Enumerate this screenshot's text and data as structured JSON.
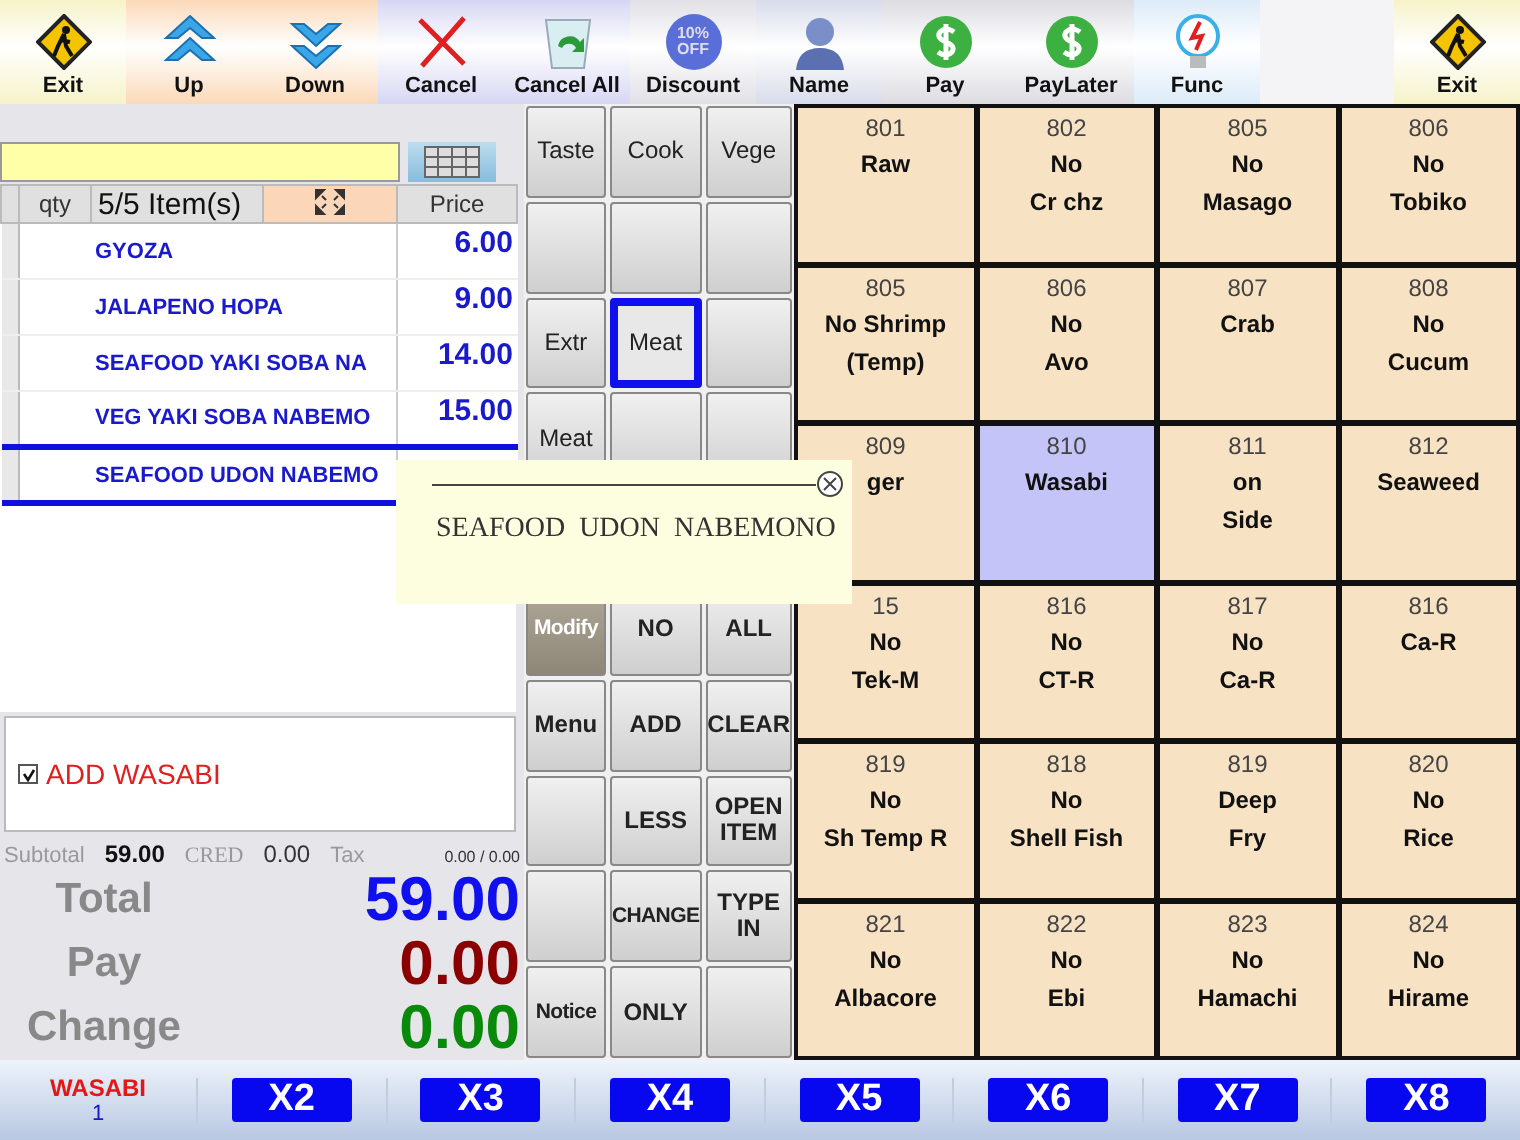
{
  "toolbar": [
    {
      "label": "Exit",
      "kind": "exit"
    },
    {
      "label": "Up",
      "kind": "up"
    },
    {
      "label": "Down",
      "kind": "down"
    },
    {
      "label": "Cancel",
      "kind": "cancel"
    },
    {
      "label": "Cancel All",
      "kind": "cancel_all"
    },
    {
      "label": "Discount",
      "kind": "discount",
      "badge": [
        "10%",
        "OFF"
      ]
    },
    {
      "label": "Name",
      "kind": "person"
    },
    {
      "label": "Pay",
      "kind": "pay"
    },
    {
      "label": "PayLater",
      "kind": "pay"
    },
    {
      "label": "Func",
      "kind": "func"
    },
    {
      "label": "Exit",
      "kind": "exit"
    }
  ],
  "order": {
    "columns": [
      "qty",
      "5/5 Item(s)",
      "Price"
    ],
    "rows": [
      {
        "item": "GYOZA",
        "price": "6.00",
        "selected": false
      },
      {
        "item": "JALAPENO HOPA",
        "price": "9.00",
        "selected": false
      },
      {
        "item": "SEAFOOD YAKI SOBA NA",
        "price": "14.00",
        "selected": false
      },
      {
        "item": "VEG YAKI SOBA NABEMO",
        "price": "15.00",
        "selected": false
      },
      {
        "item": "SEAFOOD UDON NABEMO",
        "price": "",
        "selected": true
      }
    ]
  },
  "modifiers": [
    {
      "label": "ADD WASABI",
      "checked": true
    }
  ],
  "summary": {
    "subtotal_label": "Subtotal",
    "subtotal": "59.00",
    "cred_label": "CRED",
    "cred": "0.00",
    "tax_label": "Tax",
    "tax": "0.00 / 0.00"
  },
  "totals": [
    {
      "label": "Total",
      "value": "59.00",
      "color": "#1010ee"
    },
    {
      "label": "Pay",
      "value": "0.00",
      "color": "#8b0000"
    },
    {
      "label": "Change",
      "value": "0.00",
      "color": "#0a8a0a"
    }
  ],
  "popup": {
    "text": "SEAFOOD  UDON  NABEMONO"
  },
  "keys": [
    {
      "label": "Taste",
      "selected": false,
      "kind": "key"
    },
    {
      "label": "Cook",
      "selected": false,
      "kind": "key"
    },
    {
      "label": "Vege",
      "selected": false,
      "kind": "key"
    },
    {
      "selected": false,
      "kind": "key"
    },
    {
      "selected": false,
      "kind": "key"
    },
    {
      "selected": false,
      "kind": "key"
    },
    {
      "label": "Extr",
      "selected": false,
      "kind": "key"
    },
    {
      "label": "Meat",
      "selected": true,
      "kind": "key"
    },
    {
      "selected": false,
      "kind": "key"
    },
    {
      "label": "Meat",
      "selected": false,
      "kind": "key"
    },
    {
      "selected": false,
      "kind": "key"
    },
    {
      "selected": false,
      "kind": "key"
    },
    {
      "label": "Modify",
      "selected": false,
      "kind": "mode"
    },
    {
      "label": "NO",
      "selected": false,
      "kind": "cmd"
    },
    {
      "label": "ALL",
      "selected": false,
      "kind": "cmd"
    },
    {
      "label": "Menu",
      "selected": false,
      "kind": "cmd"
    },
    {
      "label": "ADD",
      "selected": false,
      "kind": "cmd"
    },
    {
      "label": "CLEAR",
      "selected": false,
      "kind": "cmd"
    },
    {
      "selected": false,
      "kind": "cmd"
    },
    {
      "label": "LESS",
      "selected": false,
      "kind": "cmd"
    },
    {
      "label": "OPEN ITEM",
      "selected": false,
      "kind": "cmd"
    },
    {
      "selected": false,
      "kind": "cmd"
    },
    {
      "label": "CHANGE",
      "selected": false,
      "kind": "cmd"
    },
    {
      "label": "TYPE IN",
      "selected": false,
      "kind": "cmd"
    },
    {
      "label": "Notice",
      "selected": false,
      "kind": "cmd"
    },
    {
      "label": "ONLY",
      "selected": false,
      "kind": "cmd"
    },
    {
      "selected": false,
      "kind": "cmd"
    }
  ],
  "grid": [
    {
      "code": "801",
      "lines": [
        "Raw"
      ],
      "selected": false
    },
    {
      "code": "802",
      "lines": [
        "No",
        "Cr chz"
      ],
      "selected": false
    },
    {
      "code": "805",
      "lines": [
        "No",
        "Masago"
      ],
      "selected": false
    },
    {
      "code": "806",
      "lines": [
        "No",
        "Tobiko"
      ],
      "selected": false
    },
    {
      "code": "805",
      "lines": [
        "No Shrimp",
        "(Temp)"
      ],
      "selected": false
    },
    {
      "code": "806",
      "lines": [
        "No",
        "Avo"
      ],
      "selected": false
    },
    {
      "code": "807",
      "lines": [
        "Crab"
      ],
      "selected": false
    },
    {
      "code": "808",
      "lines": [
        "No",
        "Cucum"
      ],
      "selected": false
    },
    {
      "code": "809",
      "lines": [
        "ger"
      ],
      "selected": false
    },
    {
      "code": "810",
      "lines": [
        "Wasabi"
      ],
      "selected": true
    },
    {
      "code": "811",
      "lines": [
        "on",
        "Side"
      ],
      "selected": false
    },
    {
      "code": "812",
      "lines": [
        "Seaweed"
      ],
      "selected": false
    },
    {
      "code": "15",
      "lines": [
        "No",
        "Tek-M"
      ],
      "selected": false
    },
    {
      "code": "816",
      "lines": [
        "No",
        "CT-R"
      ],
      "selected": false
    },
    {
      "code": "817",
      "lines": [
        "No",
        "Ca-R"
      ],
      "selected": false
    },
    {
      "code": "816",
      "lines": [
        "Ca-R"
      ],
      "selected": false
    },
    {
      "code": "819",
      "lines": [
        "No",
        "Sh Temp R"
      ],
      "selected": false
    },
    {
      "code": "818",
      "lines": [
        "No",
        "Shell Fish"
      ],
      "selected": false
    },
    {
      "code": "819",
      "lines": [
        "Deep",
        "Fry"
      ],
      "selected": false
    },
    {
      "code": "820",
      "lines": [
        "No",
        "Rice"
      ],
      "selected": false
    },
    {
      "code": "821",
      "lines": [
        "No",
        "Albacore"
      ],
      "selected": false
    },
    {
      "code": "822",
      "lines": [
        "No",
        "Ebi"
      ],
      "selected": false
    },
    {
      "code": "823",
      "lines": [
        "No",
        "Hamachi"
      ],
      "selected": false
    },
    {
      "code": "824",
      "lines": [
        "No",
        "Hirame"
      ],
      "selected": false
    }
  ],
  "bottom": {
    "current": {
      "name": "WASABI",
      "qty": "1"
    },
    "multipliers": [
      "X2",
      "X3",
      "X4",
      "X5",
      "X6",
      "X7",
      "X8"
    ]
  }
}
